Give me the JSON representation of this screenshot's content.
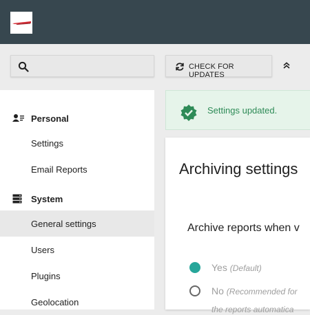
{
  "search": {
    "placeholder": ""
  },
  "toolbar": {
    "check_updates_label": "CHECK FOR UPDATES"
  },
  "sidebar": {
    "personal": {
      "label": "Personal",
      "items": [
        {
          "label": "Settings"
        },
        {
          "label": "Email Reports"
        }
      ]
    },
    "system": {
      "label": "System",
      "items": [
        {
          "label": "General settings",
          "active": true
        },
        {
          "label": "Users"
        },
        {
          "label": "Plugins"
        },
        {
          "label": "Geolocation"
        }
      ]
    }
  },
  "notification": {
    "text": "Settings updated."
  },
  "card": {
    "title": "Archiving settings",
    "question": "Archive reports when v",
    "options": [
      {
        "label": "Yes",
        "note": "(Default)",
        "checked": true
      },
      {
        "label": "No",
        "note": "(Recommended for",
        "checked": false
      }
    ],
    "continuation": "the reports automatica"
  },
  "colors": {
    "topbar": "#37474f",
    "accent": "#26a69a",
    "success_bg": "#e6f4ea",
    "success_text": "#2e8b57",
    "logo_red": "#d4202a"
  }
}
